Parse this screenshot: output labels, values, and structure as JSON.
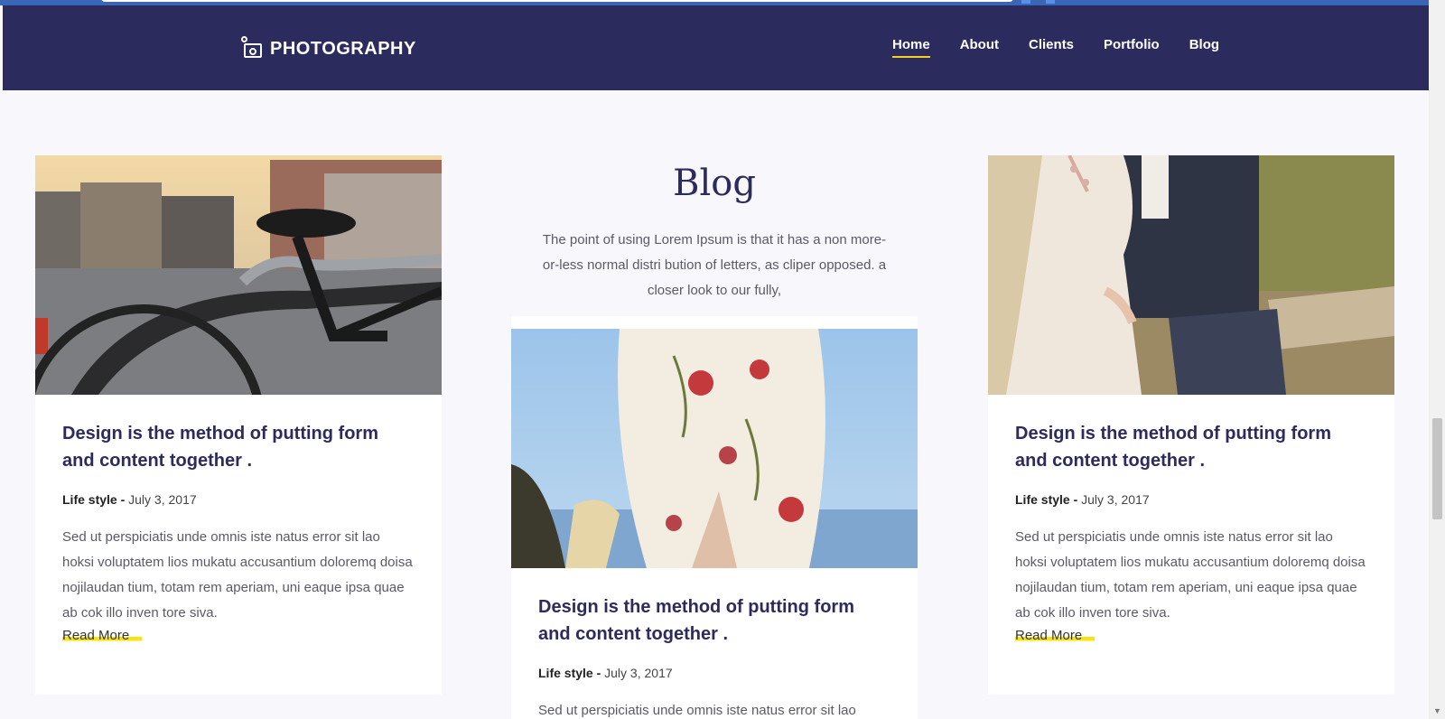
{
  "brand": {
    "name": "PHOTOGRAPHY",
    "icon": "camera-icon"
  },
  "nav": {
    "items": [
      {
        "label": "Home",
        "active": true
      },
      {
        "label": "About"
      },
      {
        "label": "Clients"
      },
      {
        "label": "Portfolio"
      },
      {
        "label": "Blog"
      }
    ]
  },
  "blog": {
    "title": "Blog",
    "intro": "The point of using Lorem Ipsum is that it has a non more-or-less normal distri bution of letters, as cliper opposed. a closer look to our fully,"
  },
  "posts": [
    {
      "image": "bicycle-photo",
      "title": "Design is the method of putting form and content together .",
      "category": "Life style -",
      "date": "July 3, 2017",
      "excerpt": "Sed ut perspiciatis unde omnis iste natus error sit lao hoksi voluptatem lios mukatu accusantium doloremq doisa nojilaudan tium, totam rem aperiam, uni eaque ipsa quae ab cok illo inven tore siva.",
      "read_more": "Read More"
    },
    {
      "image": "floral-dress-photo",
      "title": "Design is the method of putting form and content together .",
      "category": "Life style -",
      "date": "July 3, 2017",
      "excerpt": "Sed ut perspiciatis unde omnis iste natus error sit lao"
    },
    {
      "image": "wedding-couple-photo",
      "title": "Design is the method of putting form and content together .",
      "category": "Life style -",
      "date": "July 3, 2017",
      "excerpt": "Sed ut perspiciatis unde omnis iste natus error sit lao hoksi voluptatem lios mukatu accusantium doloremq doisa nojilaudan tium, totam rem aperiam, uni eaque ipsa quae ab cok illo inven tore siva.",
      "read_more": "Read More"
    }
  ],
  "colors": {
    "nav_bg": "#2b2b5e",
    "accent": "#f8e40f",
    "heading": "#2b2b5e",
    "page_bg": "#f7f7fc"
  }
}
